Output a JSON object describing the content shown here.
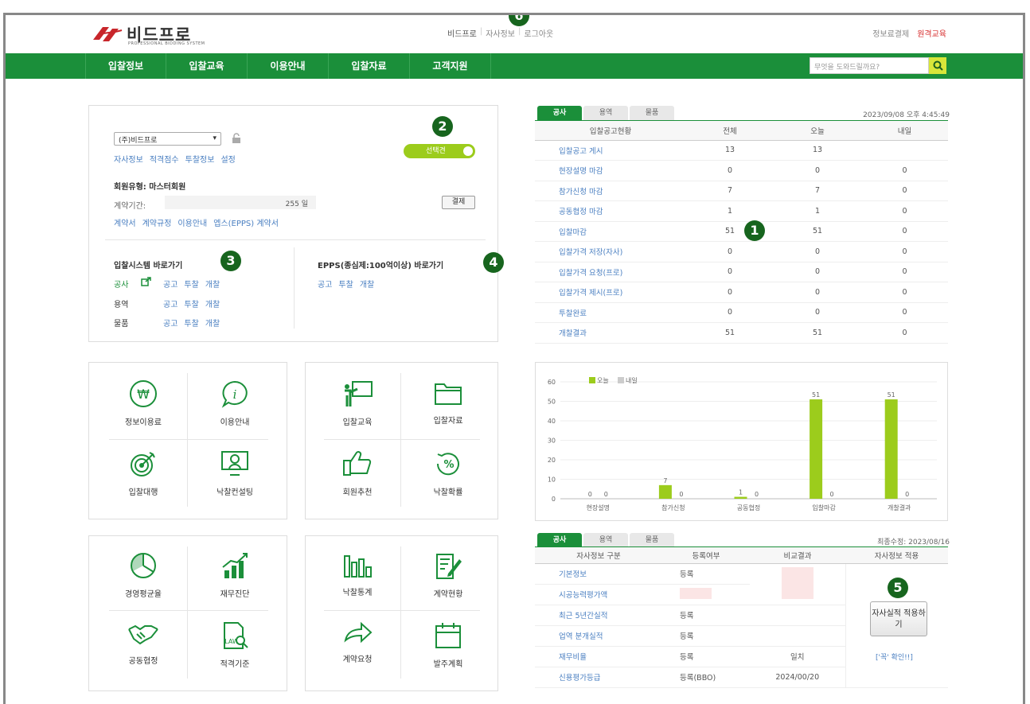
{
  "header": {
    "logo_text": "비드프로",
    "logo_sub": "PROFESSIONAL BIDDING SYSTEM",
    "top_links": [
      "비드프로",
      "자사정보",
      "로그아웃"
    ],
    "right_links": [
      "정보료결제",
      "원격교육"
    ],
    "search_placeholder": "무엇을 도와드릴까요?"
  },
  "nav": [
    "입찰정보",
    "입찰교육",
    "이용안내",
    "입찰자료",
    "고객지원"
  ],
  "badges": [
    "1",
    "2",
    "3",
    "4",
    "5",
    "6"
  ],
  "account": {
    "company": "(주)비드프로",
    "links1": [
      "자사정보",
      "적격점수",
      "투찰정보",
      "설정"
    ],
    "toggle_label": "선택견",
    "member_type": "회원유형: 마스터회원",
    "contract_label": "계약기간:",
    "contract_days": "255 일",
    "pay_button": "결제",
    "links2": [
      "계약서",
      "계약규정",
      "이용안내",
      "엡스(EPPS) 계약서"
    ]
  },
  "shortcuts": {
    "title1": "입찰시스템 바로가기",
    "title2": "EPPS(종심제:100억이상) 바로가기",
    "rows": [
      {
        "name": "공사",
        "links": [
          "공고",
          "투찰",
          "개찰"
        ]
      },
      {
        "name": "용역",
        "links": [
          "공고",
          "투찰",
          "개찰"
        ]
      },
      {
        "name": "물품",
        "links": [
          "공고",
          "투찰",
          "개찰"
        ]
      }
    ],
    "epps_links": [
      "공고",
      "투찰",
      "개찰"
    ]
  },
  "tiles1": [
    "정보이용료",
    "이용안내",
    "입찰대행",
    "낙찰컨설팅"
  ],
  "tiles2": [
    "입찰교육",
    "입찰자료",
    "회원추천",
    "낙찰확률"
  ],
  "tiles3": [
    "경영평균율",
    "재무진단",
    "공동협정",
    "적격기준"
  ],
  "tiles4": [
    "낙찰통계",
    "계약현황",
    "계약요청",
    "발주계획"
  ],
  "status_panel": {
    "tabs": [
      "공사",
      "용역",
      "물품"
    ],
    "datetime": "2023/09/08 오후 4:45:49",
    "headers": [
      "입찰공고현황",
      "전체",
      "오늘",
      "내일"
    ],
    "rows": [
      [
        "입찰공고 게시",
        "13",
        "13",
        ""
      ],
      [
        "현장설명 마감",
        "0",
        "0",
        "0"
      ],
      [
        "참가신청 마감",
        "7",
        "7",
        "0"
      ],
      [
        "공동협정 마감",
        "1",
        "1",
        "0"
      ],
      [
        "입찰마감",
        "51",
        "51",
        "0"
      ],
      [
        "입찰가격 저장(자사)",
        "0",
        "0",
        "0"
      ],
      [
        "입찰가격 요청(프로)",
        "0",
        "0",
        "0"
      ],
      [
        "입찰가격 제시(프로)",
        "0",
        "0",
        "0"
      ],
      [
        "투찰완료",
        "0",
        "0",
        "0"
      ],
      [
        "개찰결과",
        "51",
        "51",
        "0"
      ]
    ]
  },
  "chart_data": {
    "type": "bar",
    "categories": [
      "현장설명",
      "참가신청",
      "공동협정",
      "입찰마감",
      "개찰결과"
    ],
    "series": [
      {
        "name": "오늘",
        "values": [
          0,
          7,
          1,
          51,
          51
        ],
        "color": "#9ccc1c"
      },
      {
        "name": "내일",
        "values": [
          0,
          0,
          0,
          0,
          0
        ],
        "color": "#cccccc"
      }
    ],
    "ylim": [
      0,
      60
    ],
    "yticks": [
      "0",
      "10",
      "20",
      "30",
      "40",
      "50",
      "60"
    ],
    "legend": "top-left"
  },
  "company_info": {
    "tabs": [
      "공사",
      "용역",
      "물품"
    ],
    "updated": "최종수정: 2023/08/16",
    "headers": [
      "자사정보 구분",
      "등록여부",
      "비교결과",
      "자사정보 적용"
    ],
    "rows": [
      [
        "기본정보",
        "등록",
        ""
      ],
      [
        "시공능력평가액",
        "",
        ""
      ],
      [
        "최근 5년간실적",
        "등록",
        ""
      ],
      [
        "업역 분개실적",
        "등록",
        ""
      ],
      [
        "재무비율",
        "등록",
        "일치"
      ],
      [
        "신용평가등급",
        "등록(BBO)",
        "2024/00/20"
      ]
    ],
    "apply_button": "자사실적 적용하기",
    "confirm_link": "['꼭' 확인!!]"
  }
}
